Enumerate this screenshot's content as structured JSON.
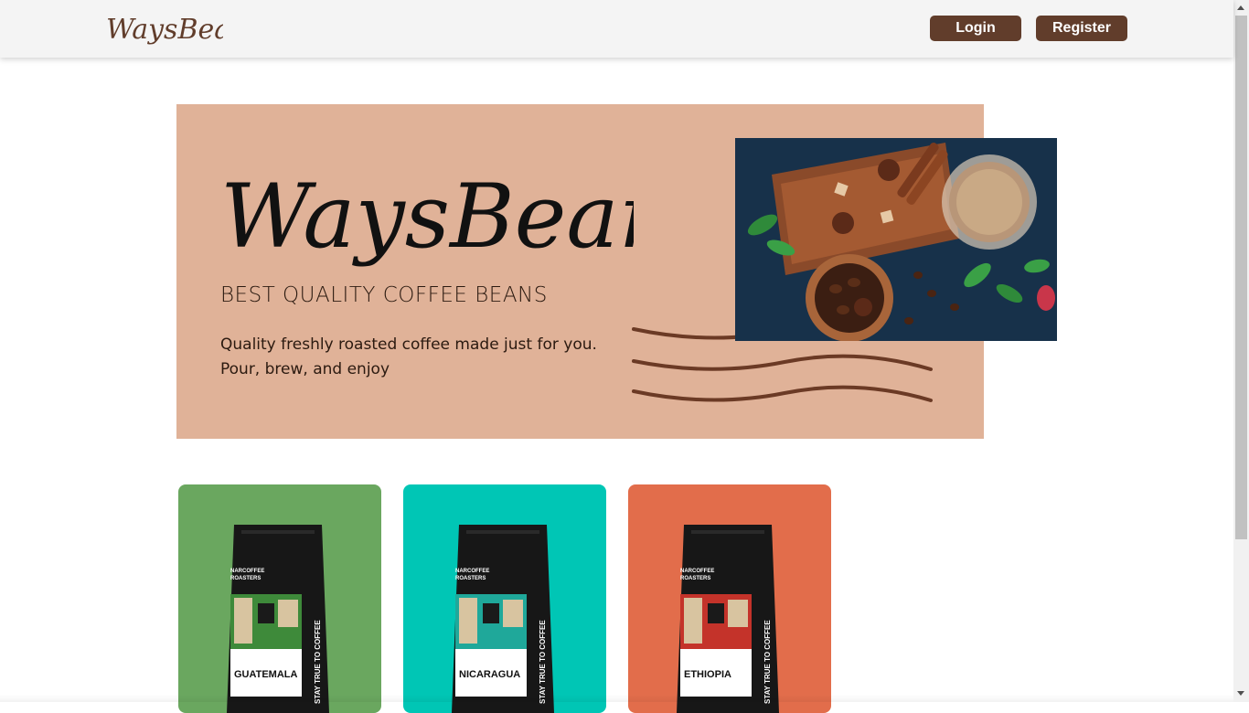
{
  "navbar": {
    "logo_text": "WaysBeans",
    "login_label": "Login",
    "register_label": "Register"
  },
  "hero": {
    "logo_text": "WaysBeans",
    "subtitle": "BEST QUALITY COFFEE BEANS",
    "description_line1": "Quality freshly roasted coffee made just for you.",
    "description_line2": "Pour, brew, and enjoy",
    "image_icon": "coffee-spices-photo-icon"
  },
  "products": [
    {
      "name": "GUATEMALA",
      "brand_line1": "NARCOFFEE",
      "brand_line2": "ROASTERS",
      "side_text": "STAY TRUE TO COFFEE",
      "bg_color": "#6aa75f",
      "accent": "#3e8a3a"
    },
    {
      "name": "NICARAGUA",
      "brand_line1": "NARCOFFEE",
      "brand_line2": "ROASTERS",
      "side_text": "STAY TRUE TO COFFEE",
      "bg_color": "#00c6b5",
      "accent": "#1fa89a"
    },
    {
      "name": "ETHIOPIA",
      "brand_line1": "NARCOFFEE",
      "brand_line2": "ROASTERS",
      "side_text": "STAY TRUE TO COFFEE",
      "bg_color": "#e26d4b",
      "accent": "#c4332a"
    }
  ],
  "colors": {
    "brand": "#613d2b",
    "navbar_bg": "#f4f4f4",
    "hero_bg": "#e0b298"
  }
}
